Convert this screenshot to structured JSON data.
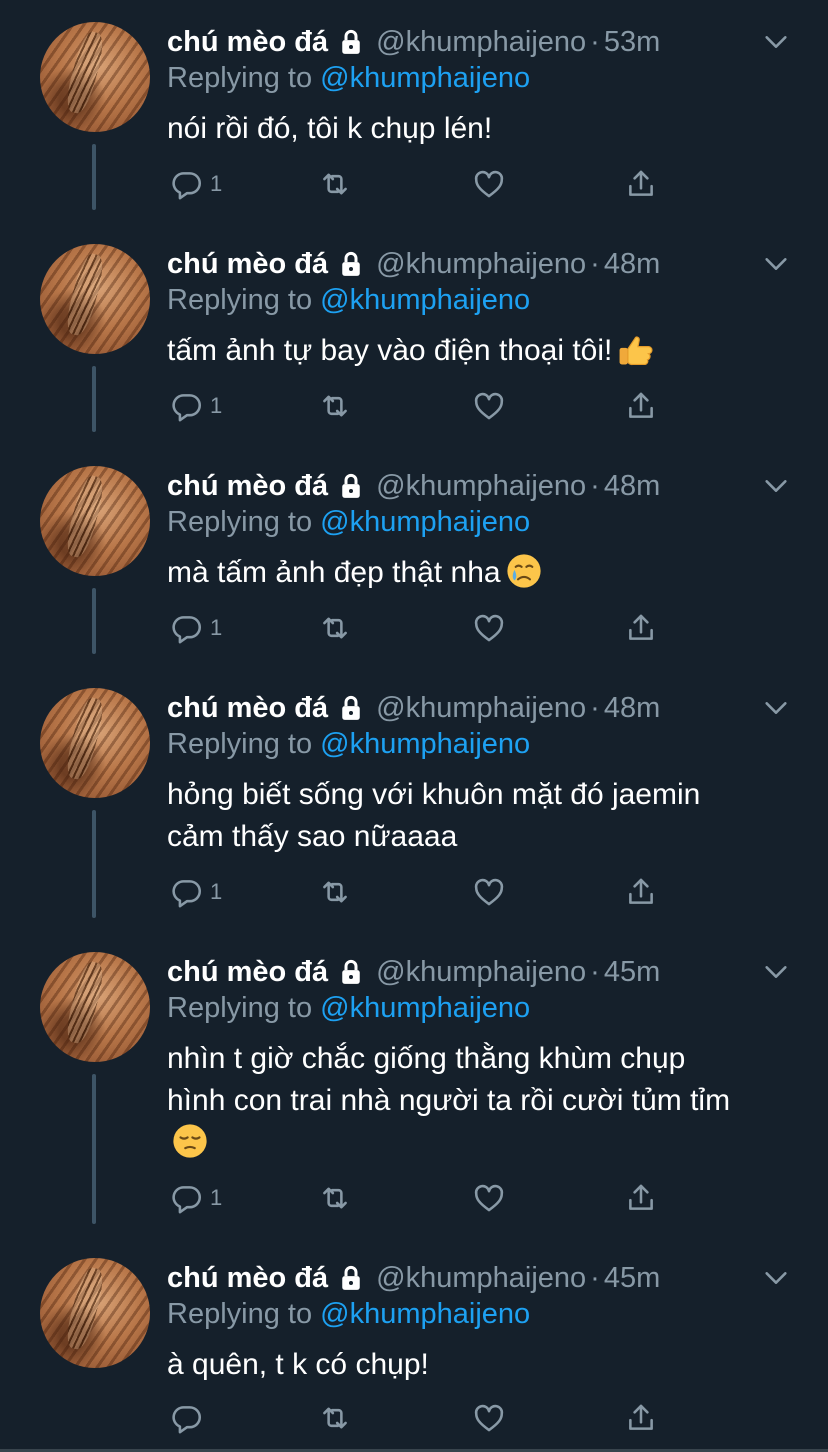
{
  "colors": {
    "background": "#15202b",
    "secondary_text": "#8899a6",
    "link": "#1da1f2",
    "thread_line": "#3d5466"
  },
  "tweets": [
    {
      "display_name": "chú mèo đá",
      "handle": "@khumphaijeno",
      "separator": "·",
      "time": "53m",
      "reply_prefix": "Replying to",
      "reply_to": "@khumphaijeno",
      "lines": [
        "nói rồi đó, tôi k chụp lén!"
      ],
      "emoji": "",
      "reply_count": "1"
    },
    {
      "display_name": "chú mèo đá",
      "handle": "@khumphaijeno",
      "separator": "·",
      "time": "48m",
      "reply_prefix": "Replying to",
      "reply_to": "@khumphaijeno",
      "lines": [
        "tấm ảnh tự bay vào điện thoại tôi!"
      ],
      "emoji": "thumbs-up",
      "reply_count": "1"
    },
    {
      "display_name": "chú mèo đá",
      "handle": "@khumphaijeno",
      "separator": "·",
      "time": "48m",
      "reply_prefix": "Replying to",
      "reply_to": "@khumphaijeno",
      "lines": [
        "mà tấm ảnh đẹp thật nha"
      ],
      "emoji": "crying-face",
      "reply_count": "1"
    },
    {
      "display_name": "chú mèo đá",
      "handle": "@khumphaijeno",
      "separator": "·",
      "time": "48m",
      "reply_prefix": "Replying to",
      "reply_to": "@khumphaijeno",
      "lines": [
        "hỏng biết sống với khuôn mặt đó jaemin",
        "cảm thấy sao nữaaaa"
      ],
      "emoji": "",
      "reply_count": "1"
    },
    {
      "display_name": "chú mèo đá",
      "handle": "@khumphaijeno",
      "separator": "·",
      "time": "45m",
      "reply_prefix": "Replying to",
      "reply_to": "@khumphaijeno",
      "lines": [
        "nhìn t giờ chắc giống thằng khùm chụp",
        "hình con trai nhà người ta rồi cười tủm tỉm"
      ],
      "emoji": "pensive-face",
      "reply_count": "1"
    },
    {
      "display_name": "chú mèo đá",
      "handle": "@khumphaijeno",
      "separator": "·",
      "time": "45m",
      "reply_prefix": "Replying to",
      "reply_to": "@khumphaijeno",
      "lines": [
        "à quên, t k có chụp!"
      ],
      "emoji": "",
      "reply_count": ""
    }
  ]
}
